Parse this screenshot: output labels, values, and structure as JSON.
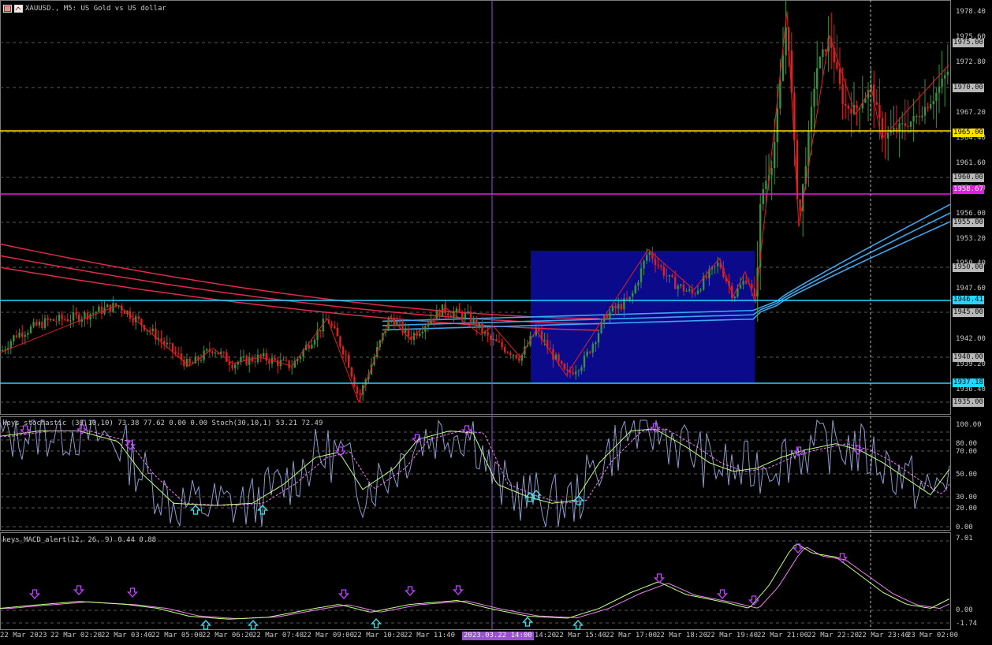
{
  "window": {
    "symbol_title": "XAUUSD., M5:  US Gold vs US dollar",
    "icons": [
      "chart-window-icon",
      "chart-type-icon"
    ]
  },
  "colors": {
    "background": "#000000",
    "grid": "#5a5a5a",
    "bull": "#3c8f3c",
    "bear": "#dd2020",
    "ma_red": "#e02a4a",
    "ma_blue": "#3fa6ee",
    "line_yellow": "#ffe000",
    "line_magenta": "#e61be6",
    "line_cyan": "#25d7ff",
    "rect_fill": "#0a0a8a",
    "stoch_main": "#b0c0ff",
    "stoch_signal": "#bfff7f",
    "macd_main": "#bfff7f",
    "macd_signal": "#ee82ee",
    "arrow_down": "#c040ff",
    "arrow_up": "#40e0e8",
    "vline": "#9a50d0"
  },
  "price_axis": {
    "ticks": [
      "1978.40",
      "1975.60",
      "1972.80",
      "1967.20",
      "1964.40",
      "1961.60",
      "1958.80",
      "1956.00",
      "1953.20",
      "1950.40",
      "1947.60",
      "1942.00",
      "1939.20",
      "1936.40"
    ],
    "tags": [
      "1975.00",
      "1970.00",
      "1965.00",
      "1960.00",
      "1958.67",
      "1955.00",
      "1950.00",
      "1946.41",
      "1945.00",
      "1940.00",
      "1937.18",
      "1935.00"
    ],
    "colored_tags": {
      "1965.00": "#ffe000",
      "1958.67": "#e61be6",
      "1946.41": "#25d7ff",
      "1937.18": "#25d7ff"
    }
  },
  "stoch": {
    "label": "keys_stochastic (30,10,10) 73.38 77.62 0.00 0.00 Stoch(30,10,1) 53.21 72.49",
    "ticks": [
      "100.00",
      "80.00",
      "70.00",
      "50.00",
      "30.00",
      "20.00",
      "0.00"
    ]
  },
  "macd": {
    "label": "keys_MACD_alert(12, 26, 9) 0.44 0.88",
    "ticks": [
      "7.01",
      "0.00",
      "-1.74"
    ]
  },
  "time_axis": {
    "labels": [
      "22 Mar 2023",
      "22 Mar 02:20",
      "22 Mar 03:40",
      "22 Mar 05:00",
      "22 Mar 06:20",
      "22 Mar 07:40",
      "22 Mar 09:00",
      "22 Mar 10:20",
      "22 Mar 11:40",
      "",
      "22 Mar 14:20",
      "22 Mar 15:40",
      "22 Mar 17:00",
      "22 Mar 18:20",
      "22 Mar 19:40",
      "22 Mar 21:00",
      "22 Mar 22:20",
      "22 Mar 23:40",
      "23 Mar 02:00"
    ],
    "highlight": "2023.03.22 14:00"
  },
  "chart_data": {
    "type": "candlestick",
    "symbol": "XAUUSD.",
    "timeframe": "M5",
    "ylim": [
      1934.5,
      1979.5
    ],
    "horizontal_levels": [
      1965.0,
      1958.67,
      1946.41,
      1937.18
    ],
    "approx_close_path": [
      1941,
      1944,
      1946,
      1943,
      1945,
      1941,
      1939,
      1942,
      1939,
      1940,
      1941,
      1944,
      1939,
      1936,
      1940,
      1944,
      1945,
      1944,
      1942,
      1940,
      1942,
      1940,
      1938,
      1941,
      1944,
      1949,
      1952,
      1949,
      1947,
      1949,
      1950,
      1947,
      1946,
      1960,
      1958,
      1974,
      1956,
      1968,
      1975,
      1970,
      1968,
      1970,
      1967,
      1966,
      1968,
      1969,
      1972
    ]
  }
}
